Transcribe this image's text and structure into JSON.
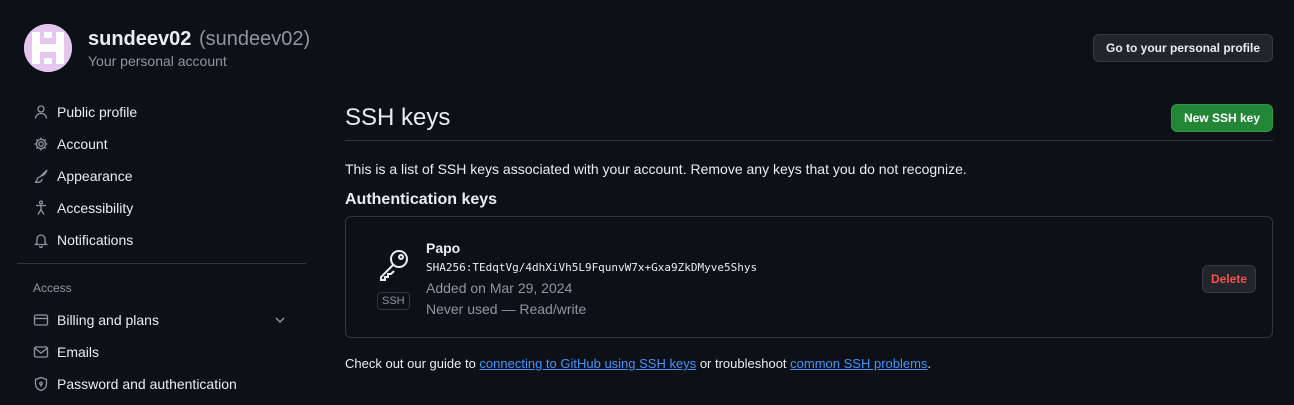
{
  "header": {
    "username": "sundeev02",
    "handle": "(sundeev02)",
    "subtitle": "Your personal account",
    "profile_button": "Go to your personal profile"
  },
  "sidebar": {
    "items": [
      {
        "label": "Public profile",
        "icon": "person-icon"
      },
      {
        "label": "Account",
        "icon": "gear-icon"
      },
      {
        "label": "Appearance",
        "icon": "paintbrush-icon"
      },
      {
        "label": "Accessibility",
        "icon": "accessibility-icon"
      },
      {
        "label": "Notifications",
        "icon": "bell-icon"
      }
    ],
    "access_label": "Access",
    "access_items": [
      {
        "label": "Billing and plans",
        "icon": "credit-card-icon",
        "has_chevron": true
      },
      {
        "label": "Emails",
        "icon": "mail-icon"
      },
      {
        "label": "Password and authentication",
        "icon": "shield-lock-icon"
      }
    ]
  },
  "main": {
    "title": "SSH keys",
    "new_button": "New SSH key",
    "intro": "This is a list of SSH keys associated with your account. Remove any keys that you do not recognize.",
    "auth_title": "Authentication keys",
    "keys": [
      {
        "name": "Papo",
        "fingerprint": "SHA256:TEdqtVg/4dhXiVh5L9FqunvW7x+Gxa9ZkDMyve5Shys",
        "added": "Added on Mar 29, 2024",
        "usage": "Never used — Read/write",
        "badge": "SSH",
        "delete_label": "Delete"
      }
    ],
    "footer": {
      "prefix": "Check out our guide to ",
      "link1": "connecting to GitHub using SSH keys",
      "middle": " or troubleshoot ",
      "link2": "common SSH problems",
      "suffix": "."
    }
  },
  "colors": {
    "background": "#0d1117",
    "accent_link": "#4493f8",
    "primary_button": "#238636",
    "danger": "#f85149"
  }
}
